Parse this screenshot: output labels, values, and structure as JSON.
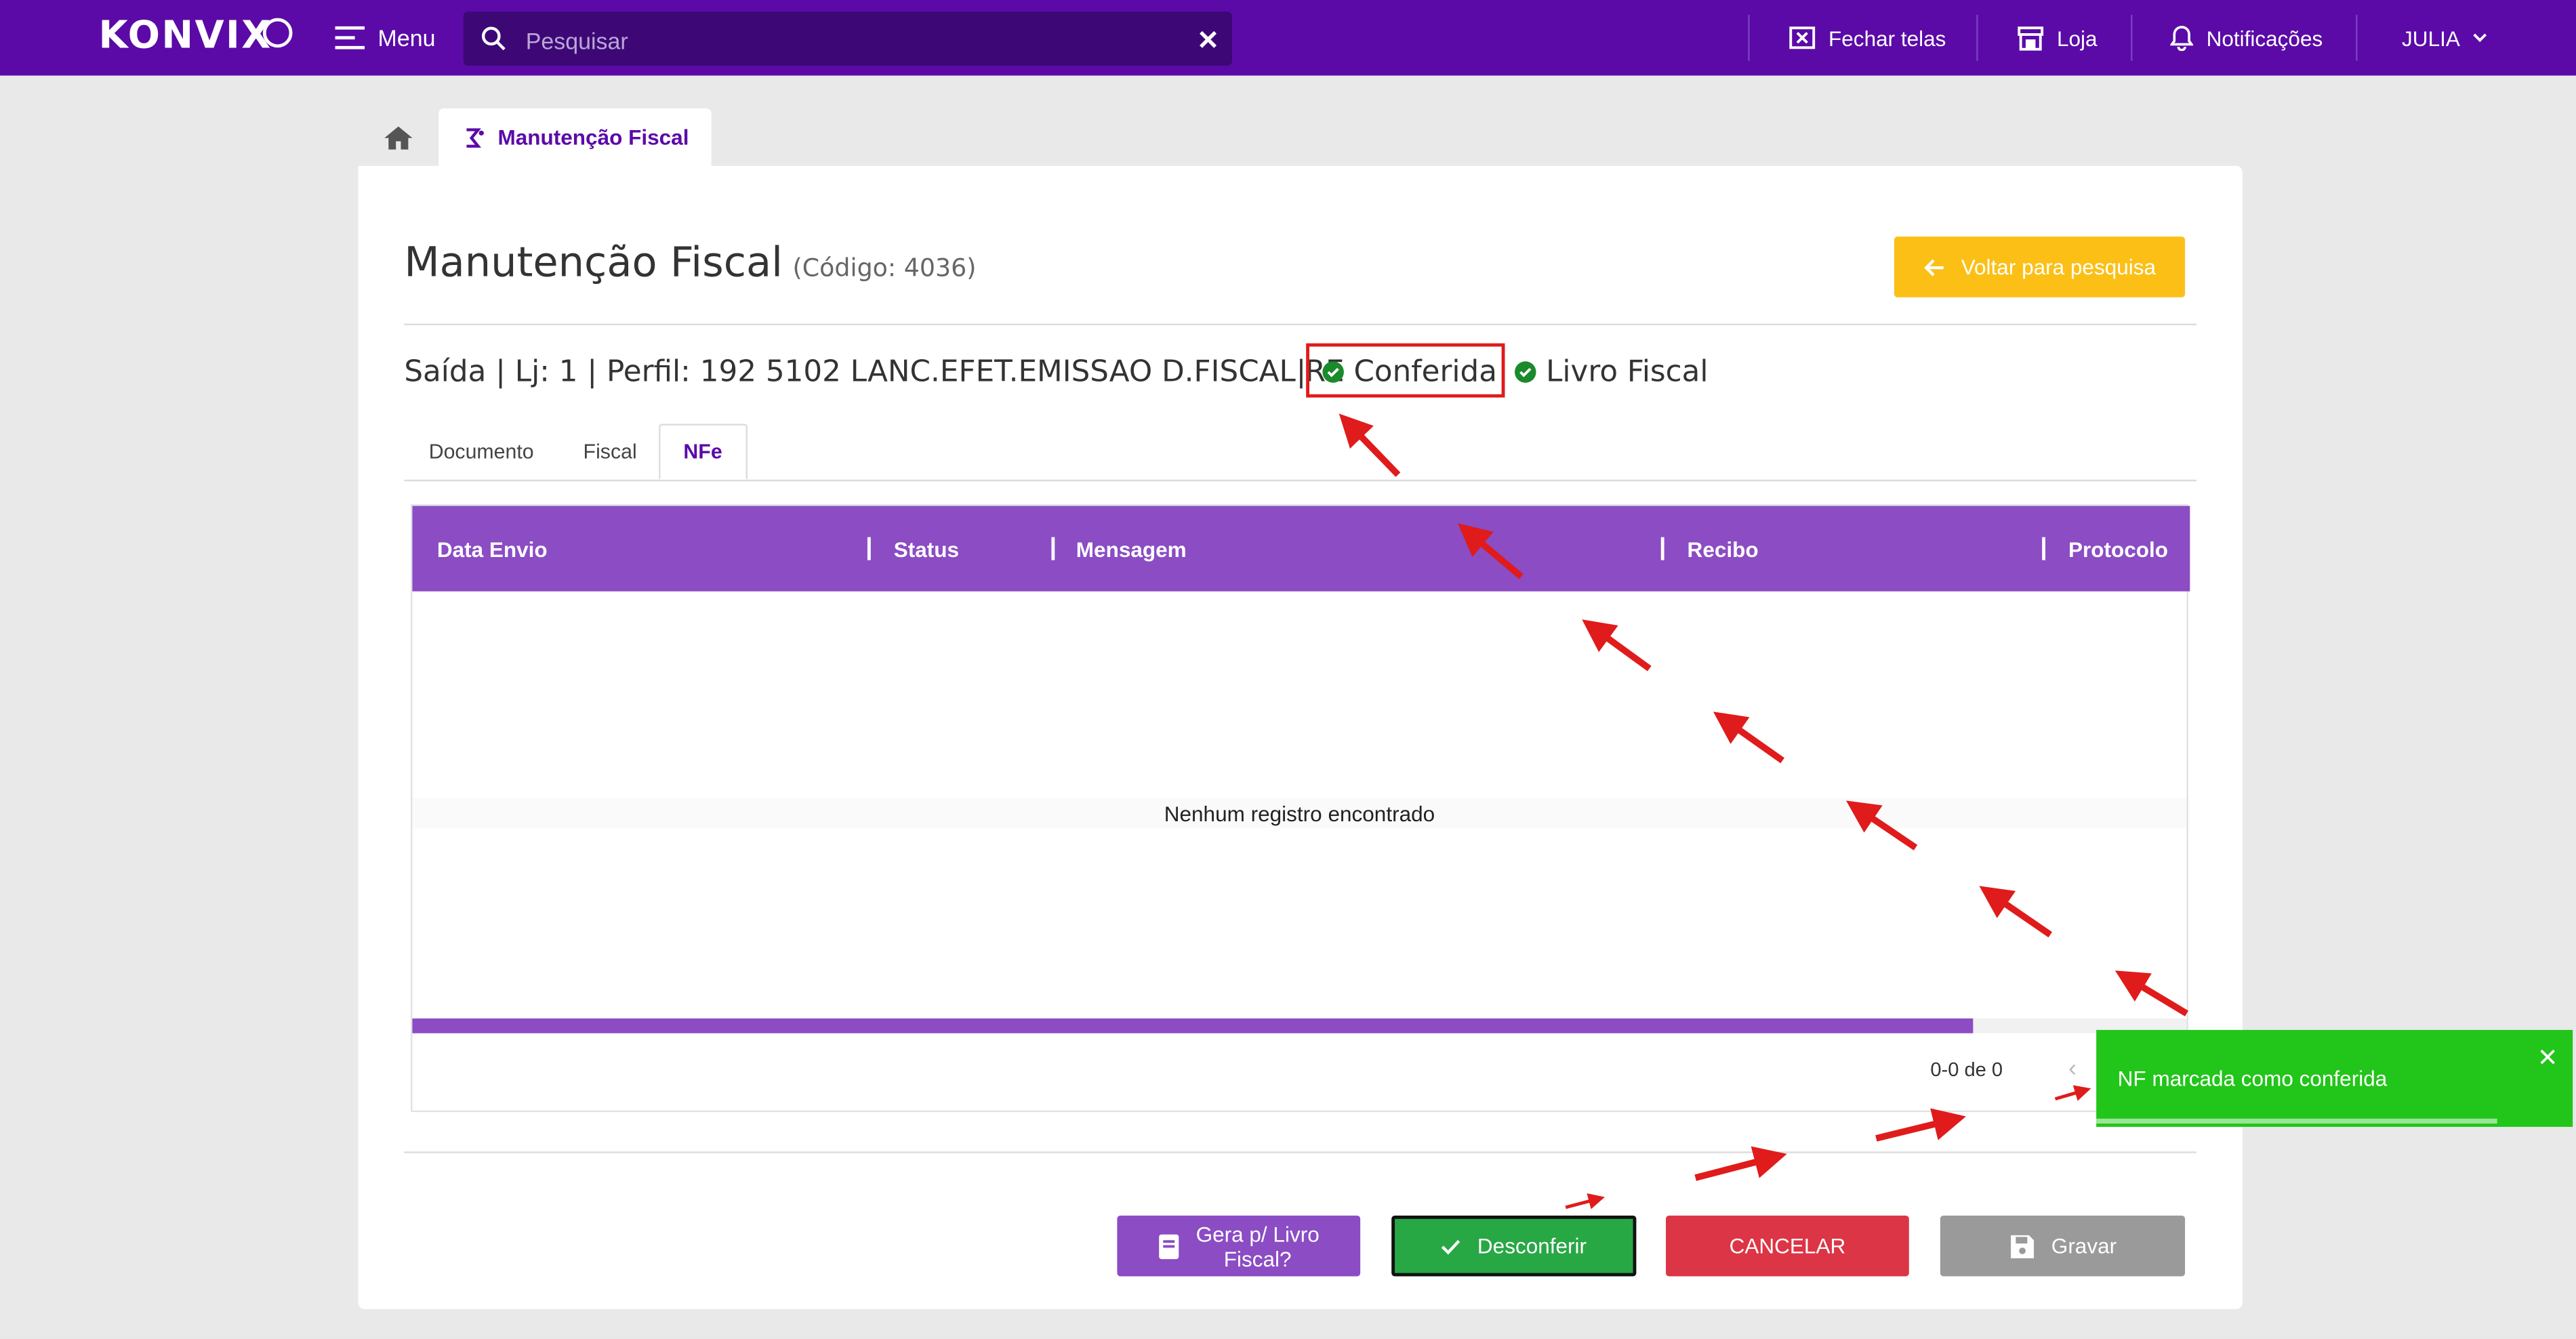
{
  "topbar": {
    "logo": "KONVIX",
    "menu_label": "Menu",
    "search_placeholder": "Pesquisar",
    "close_screens": "Fechar telas",
    "store": "Loja",
    "notifications": "Notificações",
    "user": "JULIA"
  },
  "tabs": {
    "page_tab": "Manutenção Fiscal"
  },
  "page": {
    "title": "Manutenção Fiscal",
    "code": "(Código: 4036)",
    "back_button": "Voltar para pesquisa",
    "info_line": "Saída | Lj: 1 | Perfil: 192 5102 LANC.EFET.EMISSAO D.FISCAL RE",
    "separator": "|",
    "status_checked": "Conferida",
    "status_book": "Livro Fiscal"
  },
  "subtabs": [
    "Documento",
    "Fiscal",
    "NFe"
  ],
  "grid": {
    "columns": [
      "Data Envio",
      "Status",
      "Mensagem",
      "Recibo",
      "Protocolo"
    ],
    "empty_message": "Nenhum registro encontrado",
    "pager_text": "0-0 de 0",
    "scroll_fraction": 0.88
  },
  "buttons": {
    "book_line1": "Gera p/ Livro",
    "book_line2": "Fiscal?",
    "unconfirm": "Desconferir",
    "cancel": "CANCELAR",
    "save": "Gravar"
  },
  "toast": {
    "message": "NF marcada como conferida"
  },
  "colors": {
    "brand": "#5b0aa8",
    "grid_header": "#8b4cc4",
    "back_button": "#fbbf16",
    "book_button": "#8b4cc4",
    "unconfirm_button": "#28a745",
    "cancel_button": "#dc3545",
    "save_button": "#9a9a9a",
    "toast": "#22c51a",
    "annotation": "#e01b1b"
  }
}
